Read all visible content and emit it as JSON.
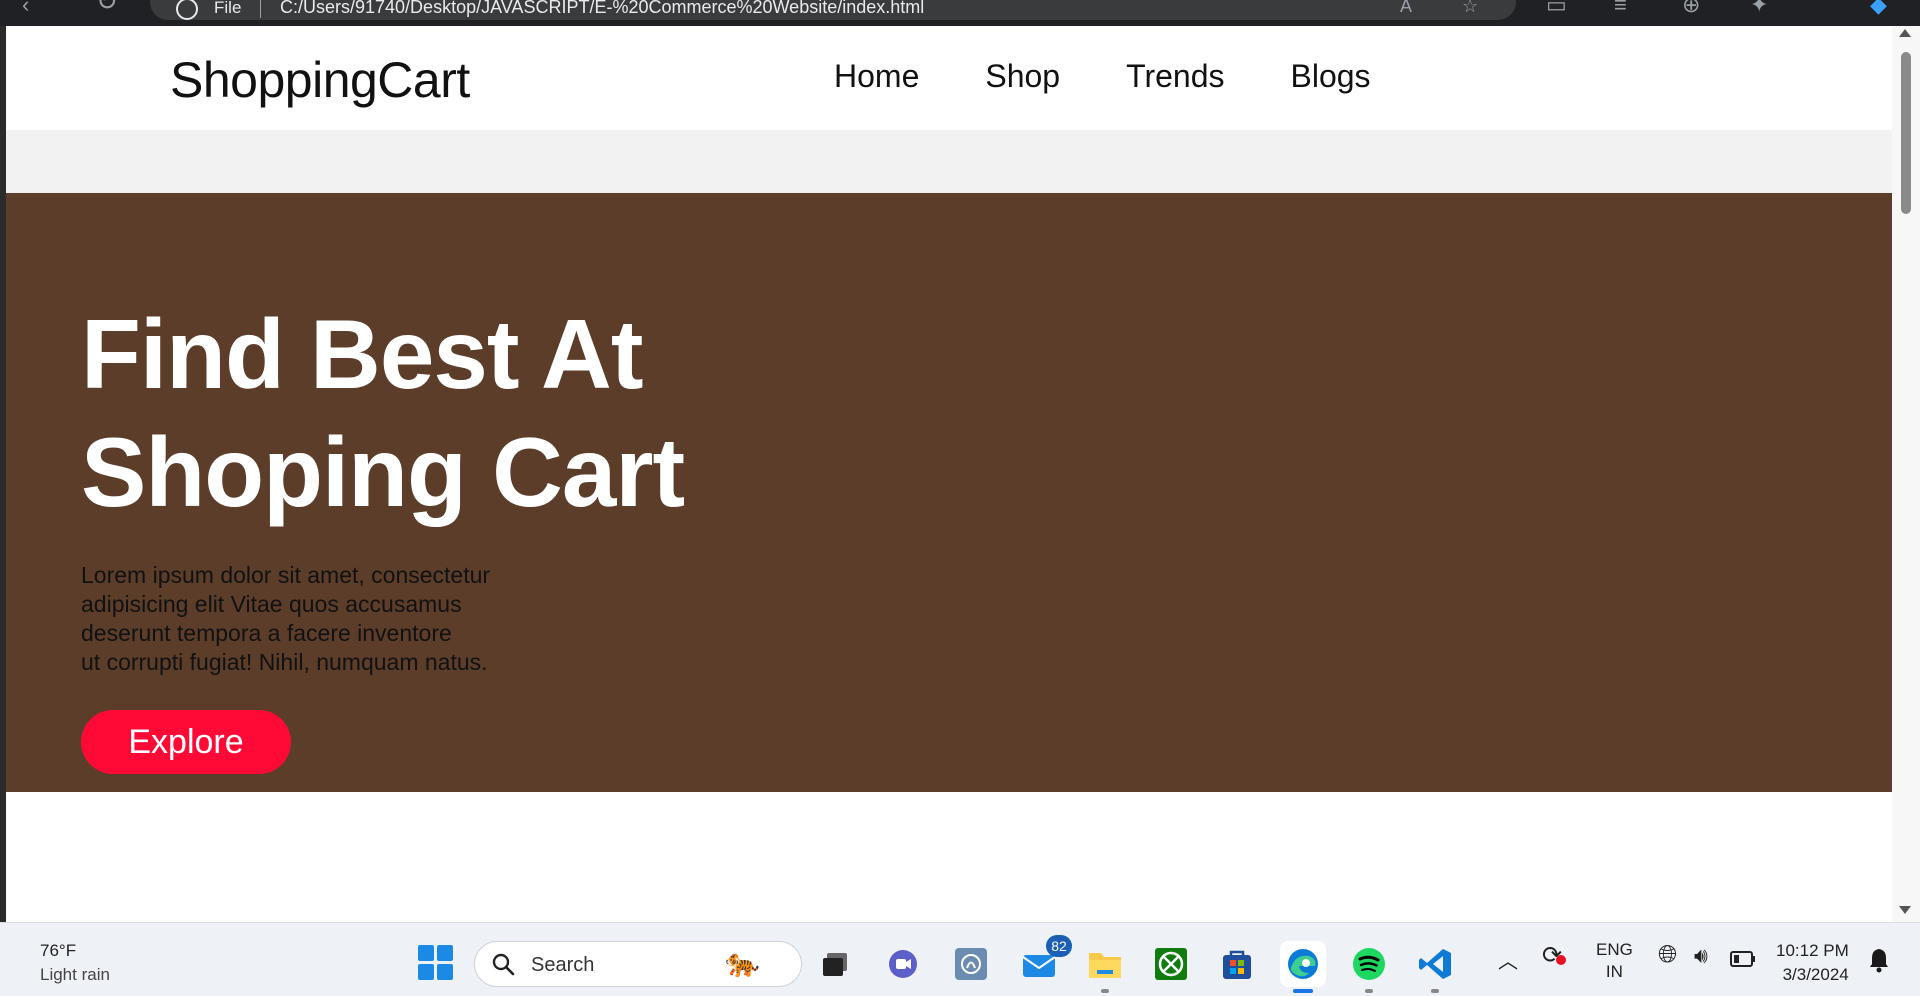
{
  "browser": {
    "address_label": "File",
    "url": "C:/Users/91740/Desktop/JAVASCRIPT/E-%20Commerce%20Website/index.html"
  },
  "site": {
    "logo": "ShoppingCart",
    "nav": [
      "Home",
      "Shop",
      "Trends",
      "Blogs"
    ],
    "hero": {
      "title_line1": "Find Best At",
      "title_line2": "Shoping Cart",
      "text_lines": [
        "Lorem ipsum dolor sit amet, consectetur",
        "adipisicing elit Vitae quos accusamus",
        "deserunt tempora a facere inventore",
        "ut corrupti fugiat! Nihil, numquam natus."
      ],
      "button": "Explore"
    },
    "colors": {
      "hero_bg": "#5c3d2a",
      "button_bg": "#ff0a36"
    }
  },
  "taskbar": {
    "weather_temp": "76°F",
    "weather_desc": "Light rain",
    "search_placeholder": "Search",
    "mail_badge": "82",
    "lang_top": "ENG",
    "lang_bottom": "IN",
    "time": "10:12 PM",
    "date": "3/3/2024",
    "apps": [
      "task-view-icon",
      "teams-icon",
      "copilot-icon",
      "mail-icon",
      "file-explorer-icon",
      "xbox-icon",
      "store-icon",
      "edge-icon",
      "spotify-icon",
      "vscode-icon"
    ]
  }
}
